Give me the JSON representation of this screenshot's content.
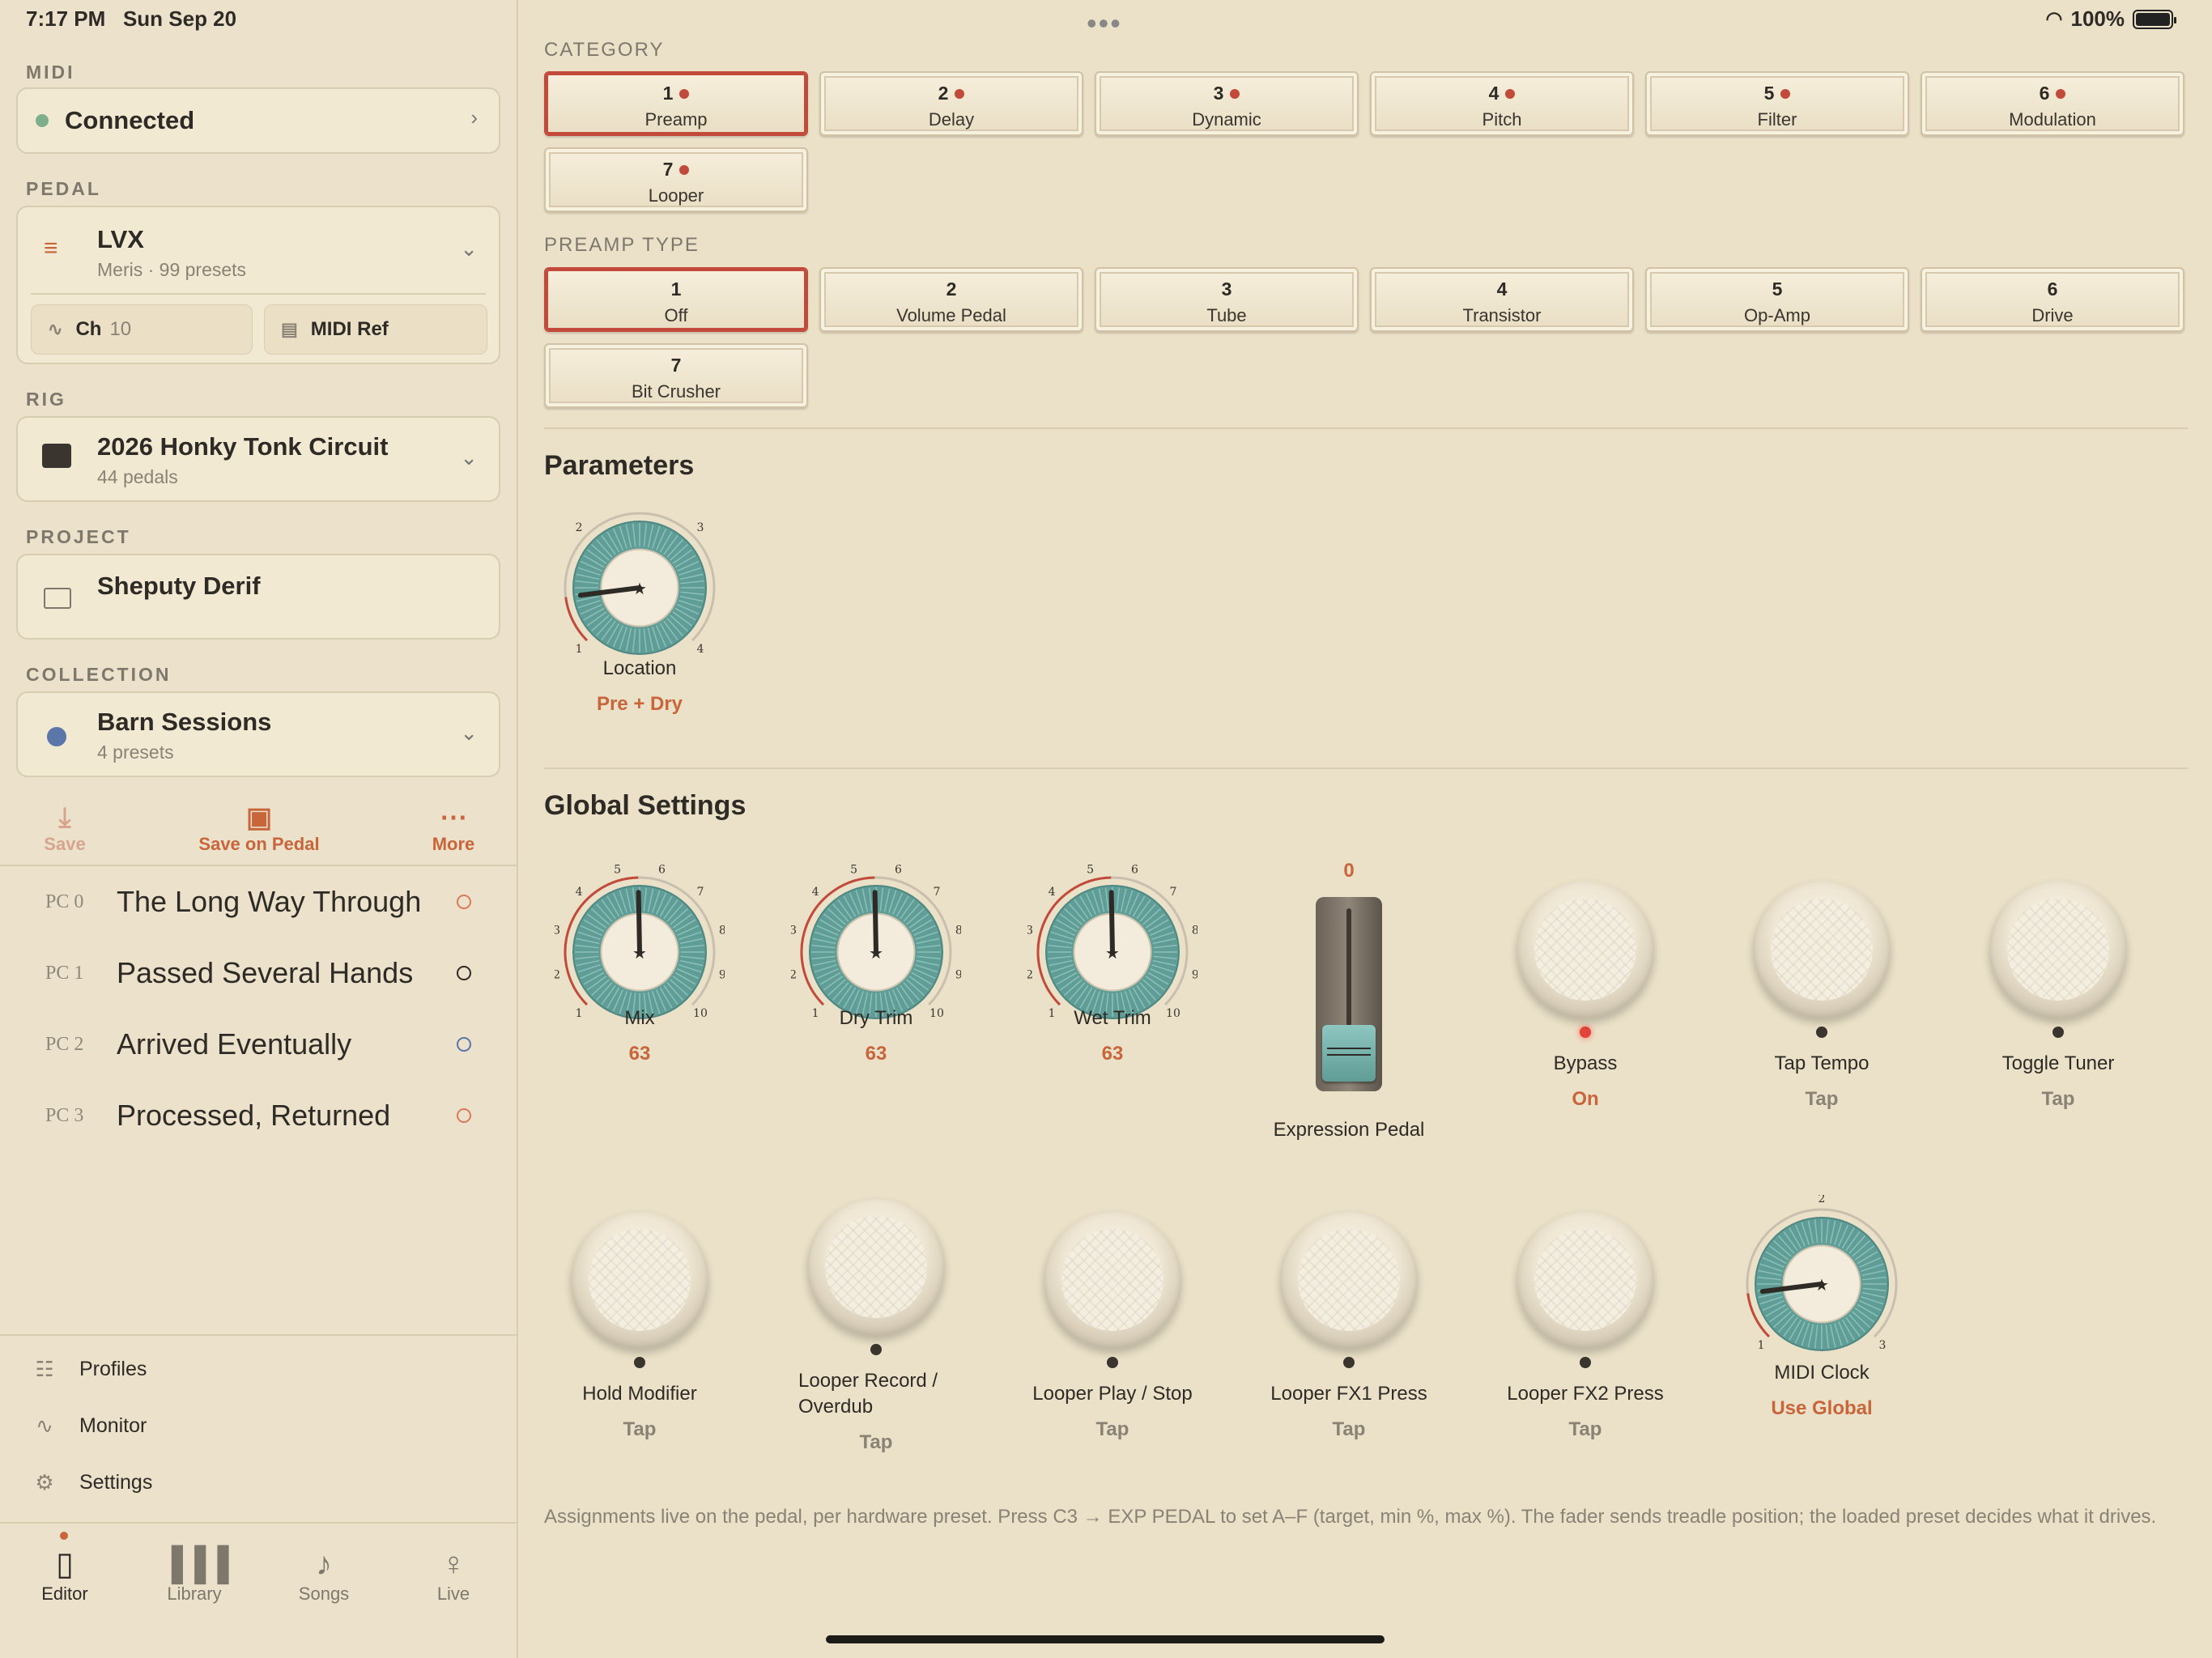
{
  "status": {
    "time": "7:17 PM",
    "date": "Sun Sep 20",
    "battery": "100%",
    "wifi_icon": "wifi-icon",
    "battery_level": 1.0
  },
  "sidebar": {
    "midi": {
      "label": "MIDI",
      "status": "Connected",
      "status_color": "#7fae8c"
    },
    "pedal": {
      "label": "PEDAL",
      "name": "LVX",
      "sub": "Meris · 99 presets",
      "channel_label": "Ch",
      "channel_value": "10",
      "midi_ref": "MIDI Ref"
    },
    "rig": {
      "label": "RIG",
      "name": "2026 Honky Tonk Circuit",
      "sub": "44 pedals"
    },
    "project": {
      "label": "PROJECT",
      "name": "Sheputy Derif"
    },
    "collection": {
      "label": "COLLECTION",
      "name": "Barn Sessions",
      "sub": "4 presets",
      "dot_color": "#5b76a8"
    },
    "actions": {
      "save": "Save",
      "save_on_pedal": "Save on Pedal",
      "more": "More"
    },
    "presets": [
      {
        "pc": "PC 0",
        "title": "The Long Way Through",
        "ring_color": "#d97a5a"
      },
      {
        "pc": "PC 1",
        "title": "Passed Several Hands",
        "ring_color": "#2e2a25"
      },
      {
        "pc": "PC 2",
        "title": "Arrived Eventually",
        "ring_color": "#5b76a8"
      },
      {
        "pc": "PC 3",
        "title": "Processed, Returned",
        "ring_color": "#d97a5a"
      }
    ],
    "nav": [
      {
        "label": "Profiles",
        "icon": "profiles-icon"
      },
      {
        "label": "Monitor",
        "icon": "pulse-icon"
      },
      {
        "label": "Settings",
        "icon": "gear-icon"
      }
    ],
    "tabs": [
      {
        "label": "Editor",
        "icon": "pedal-icon"
      },
      {
        "label": "Library",
        "icon": "books-icon"
      },
      {
        "label": "Songs",
        "icon": "songs-icon"
      },
      {
        "label": "Live",
        "icon": "mic-icon"
      }
    ]
  },
  "main": {
    "category": {
      "label": "CATEGORY",
      "items": [
        {
          "num": "1",
          "label": "Preamp"
        },
        {
          "num": "2",
          "label": "Delay"
        },
        {
          "num": "3",
          "label": "Dynamic"
        },
        {
          "num": "4",
          "label": "Pitch"
        },
        {
          "num": "5",
          "label": "Filter"
        },
        {
          "num": "6",
          "label": "Modulation"
        },
        {
          "num": "7",
          "label": "Looper"
        }
      ],
      "selected": "1"
    },
    "preamp_type": {
      "label": "PREAMP TYPE",
      "items": [
        {
          "num": "1",
          "label": "Off"
        },
        {
          "num": "2",
          "label": "Volume Pedal"
        },
        {
          "num": "3",
          "label": "Tube"
        },
        {
          "num": "4",
          "label": "Transistor"
        },
        {
          "num": "5",
          "label": "Op-Amp"
        },
        {
          "num": "6",
          "label": "Drive"
        },
        {
          "num": "7",
          "label": "Bit Crusher"
        }
      ],
      "selected": "1"
    },
    "parameters": {
      "title": "Parameters",
      "location": {
        "name": "Location",
        "value": "Pre + Dry",
        "ticks": [
          "1",
          "2",
          "3",
          "4"
        ],
        "position": 1
      }
    },
    "global": {
      "title": "Global Settings",
      "mix": {
        "name": "Mix",
        "value": "63",
        "ticks": [
          "1",
          "2",
          "3",
          "4",
          "5",
          "6",
          "7",
          "8",
          "9",
          "10"
        ]
      },
      "dry_trim": {
        "name": "Dry Trim",
        "value": "63",
        "ticks": [
          "1",
          "2",
          "3",
          "4",
          "5",
          "6",
          "7",
          "8",
          "9",
          "10"
        ]
      },
      "wet_trim": {
        "name": "Wet Trim",
        "value": "63",
        "ticks": [
          "1",
          "2",
          "3",
          "4",
          "5",
          "6",
          "7",
          "8",
          "9",
          "10"
        ]
      },
      "expression": {
        "name": "Expression Pedal",
        "value": "0"
      },
      "bypass": {
        "name": "Bypass",
        "value": "On"
      },
      "tap_tempo": {
        "name": "Tap Tempo",
        "value": "Tap"
      },
      "toggle_tuner": {
        "name": "Toggle Tuner",
        "value": "Tap"
      },
      "hold_modifier": {
        "name": "Hold Modifier",
        "value": "Tap"
      },
      "looper_record": {
        "name": "Looper Record / Overdub",
        "value": "Tap"
      },
      "looper_play": {
        "name": "Looper Play / Stop",
        "value": "Tap"
      },
      "looper_fx1": {
        "name": "Looper FX1 Press",
        "value": "Tap"
      },
      "looper_fx2": {
        "name": "Looper FX2 Press",
        "value": "Tap"
      },
      "midi_clock": {
        "name": "MIDI Clock",
        "value": "Use Global",
        "ticks": [
          "1",
          "2",
          "3"
        ],
        "position": 1
      }
    },
    "footnote": "Assignments live on the pedal, per hardware preset. Press C3 → EXP PEDAL to set A–F (target, min %, max %). The fader sends treadle position; the loaded preset decides what it drives."
  },
  "colors": {
    "accent": "#c8653b",
    "selected_border": "#c24a3a",
    "knob_teal": "#5f9d96"
  }
}
